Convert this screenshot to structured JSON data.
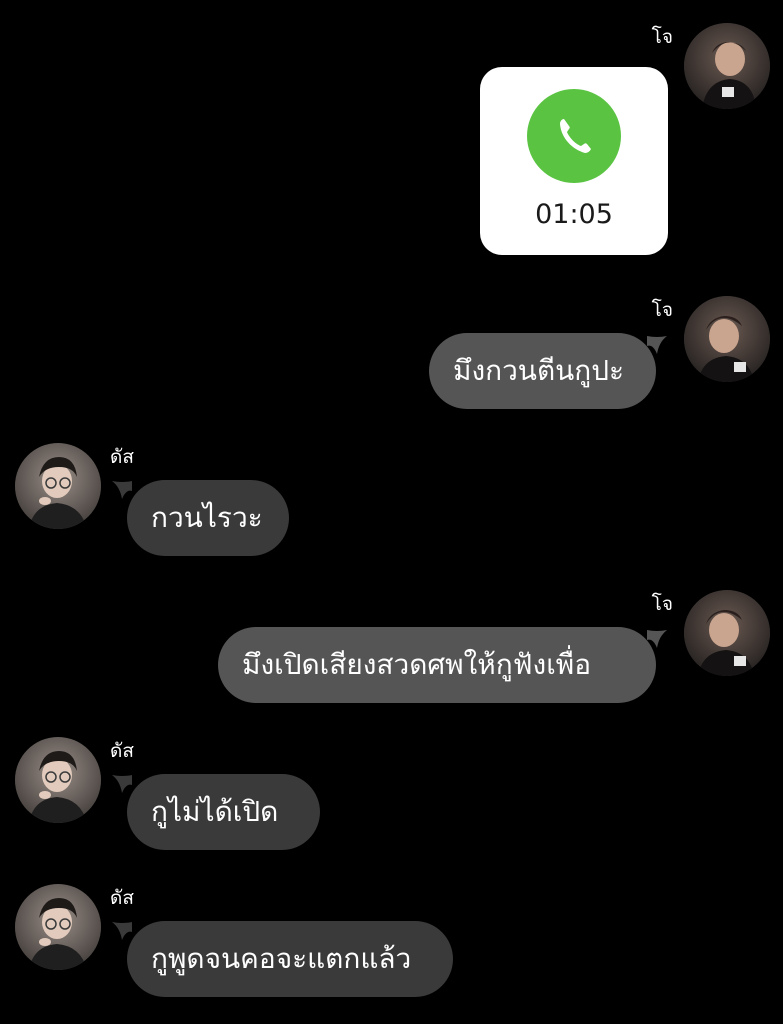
{
  "chat": {
    "contacts": {
      "jo": {
        "name": "โจ",
        "avatar_icon": "avatar-jo"
      },
      "das": {
        "name": "ดัส",
        "avatar_icon": "avatar-das"
      }
    },
    "call": {
      "duration": "01:05",
      "icon": "phone-icon",
      "accent_color": "#5AC442"
    },
    "messages": [
      {
        "sender": "โจ",
        "text": "มึงกวนตีนกูปะ"
      },
      {
        "sender": "ดัส",
        "text": "กวนไรวะ"
      },
      {
        "sender": "โจ",
        "text": "มึงเปิดเสียงสวดศพให้กูฟังเพื่อ"
      },
      {
        "sender": "ดัส",
        "text": "กูไม่ได้เปิด"
      },
      {
        "sender": "ดัส",
        "text": "กูพูดจนคอจะแตกแล้ว"
      }
    ]
  },
  "colors": {
    "background": "#000000",
    "outgoing_bubble": "#555555",
    "incoming_bubble": "#3A3A3A",
    "call_card": "#FFFFFF"
  }
}
